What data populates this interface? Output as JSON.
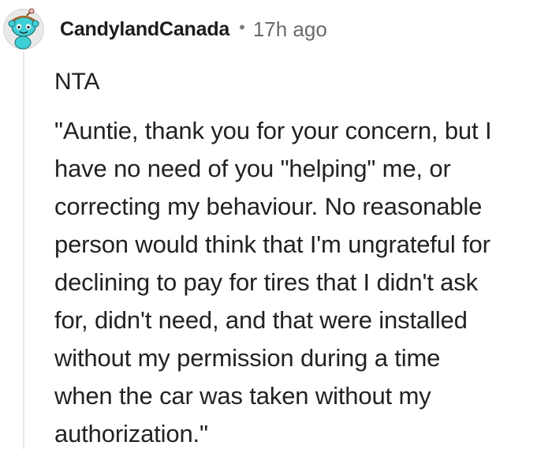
{
  "comment": {
    "author": "CandylandCanada",
    "separator": "•",
    "timestamp": "17h ago",
    "avatar_icon": "snoo-avatar-icon",
    "paragraphs": [
      "NTA",
      "\"Auntie, thank you for your concern, but I\nhave no need of you \"helping\" me, or\ncorrecting my behaviour. No reasonable\nperson would think that I'm ungrateful for\ndeclining to pay for tires that I didn't ask\nfor, didn't need, and that were installed\nwithout my permission during a time\nwhen the car was taken without my\nauthorization.\""
    ]
  },
  "colors": {
    "text": "#1c1c1c",
    "meta": "#6a6a6a",
    "thread_line": "#e6e6e6",
    "avatar_teal": "#3fd0d6"
  }
}
